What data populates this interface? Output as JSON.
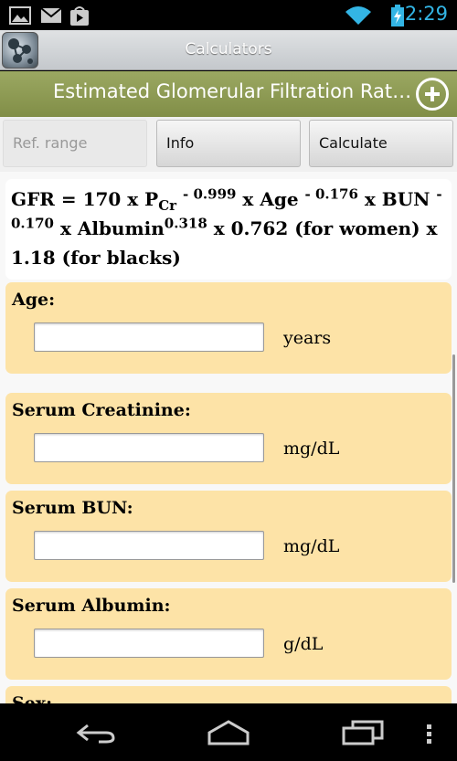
{
  "status_bar": {
    "time": "2:29",
    "icons": [
      "image-icon",
      "gmail-icon",
      "play-store-icon",
      "wifi-icon",
      "battery-charging-icon"
    ]
  },
  "title_bar": {
    "title": "Calculators"
  },
  "header": {
    "title": "Estimated Glomerular Filtration Rat…",
    "add_icon": "add-circle-icon"
  },
  "buttons": {
    "ref_range": "Ref. range",
    "info": "Info",
    "calculate": "Calculate"
  },
  "formula": {
    "parts": {
      "a": "GFR = 170 x P",
      "cr": "Cr",
      "e1": "- 0.999",
      "b": " x Age ",
      "e2": "- 0.176",
      "c": " x BUN ",
      "e3": "- 0.170",
      "d": " x Albumin",
      "e4": "0.318",
      "e": " x 0.762 (for women) x 1.18 (for blacks)"
    }
  },
  "fields": [
    {
      "label": "Age:",
      "value": "",
      "unit": "years"
    },
    {
      "label": "Serum Creatinine:",
      "value": "",
      "unit": "mg/dL"
    },
    {
      "label": "Serum BUN:",
      "value": "",
      "unit": "mg/dL"
    },
    {
      "label": "Serum Albumin:",
      "value": "",
      "unit": "g/dL"
    },
    {
      "label": "Sex:"
    }
  ],
  "nav_bar": {
    "icons": [
      "back-icon",
      "home-icon",
      "recent-apps-icon",
      "menu-icon"
    ]
  },
  "colors": {
    "header_green": "#8e9b53",
    "card_bg": "#fde3a7",
    "time_blue": "#33b5e5"
  }
}
